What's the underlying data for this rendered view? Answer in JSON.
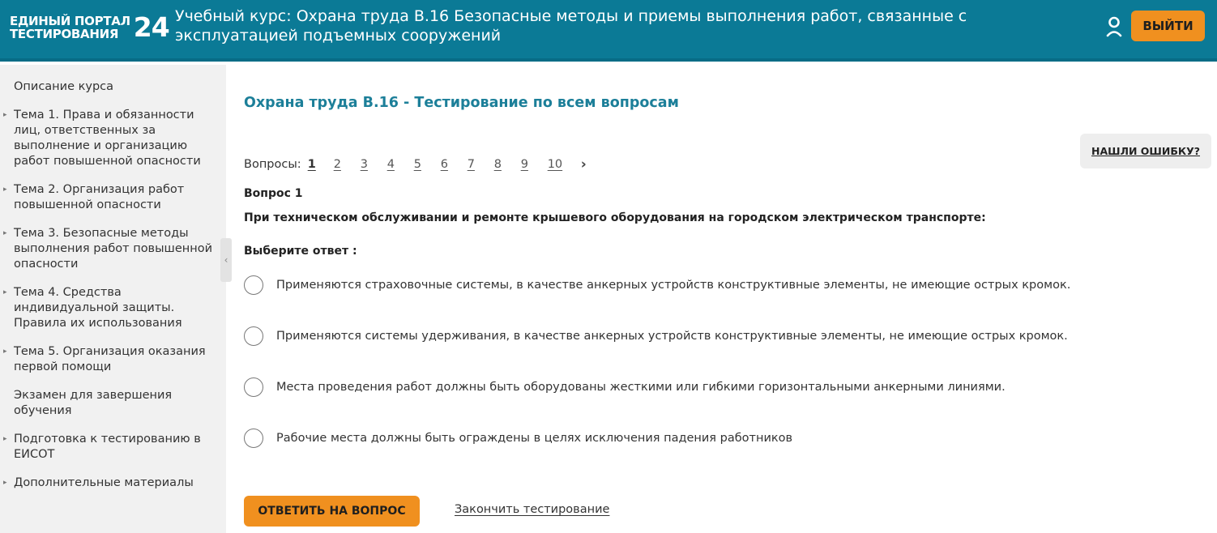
{
  "header": {
    "logo_line1": "ЕДИНЫЙ ПОРТАЛ",
    "logo_line2": "ТЕСТИРОВАНИЯ",
    "logo_number": "24",
    "title": "Учебный курс: Охрана труда В.16 Безопасные методы и приемы выполнения работ, связанные с эксплуатацией подъемных сооружений",
    "user_icon": "user-icon",
    "logout_label": "ВЫЙТИ"
  },
  "sidebar": {
    "items": [
      {
        "label": "Описание курса",
        "arrow": false
      },
      {
        "label": "Тема 1. Права и обязанности лиц, ответственных за выполнение и организацию работ повышенной опасности",
        "arrow": true
      },
      {
        "label": "Тема 2. Организация работ повышенной опасности",
        "arrow": true
      },
      {
        "label": "Тема 3. Безопасные методы выполнения работ повышенной опасности",
        "arrow": true
      },
      {
        "label": "Тема 4. Средства индивидуальной защиты. Правила их использования",
        "arrow": true
      },
      {
        "label": "Тема 5. Организация оказания первой помощи",
        "arrow": true
      },
      {
        "label": "Экзамен для завершения обучения",
        "arrow": false
      },
      {
        "label": "Подготовка к тестированию в ЕИСОТ",
        "arrow": true
      },
      {
        "label": "Дополнительные материалы",
        "arrow": true
      }
    ]
  },
  "main": {
    "title": "Охрана труда В.16 - Тестирование по всем вопросам",
    "report_error_label": "НАШЛИ ОШИБКУ?",
    "pager": {
      "label": "Вопросы:",
      "pages": [
        "1",
        "2",
        "3",
        "4",
        "5",
        "6",
        "7",
        "8",
        "9",
        "10"
      ],
      "current": "1",
      "next": "›"
    },
    "question_number": "Вопрос 1",
    "question_text": "При техническом обслуживании и ремонте крышевого оборудования на городском электрическом транспорте:",
    "choose_label": "Выберите ответ :",
    "options": [
      "Применяются страховочные системы, в качестве анкерных устройств конструктивные элементы, не имеющие острых кромок.",
      "Применяются системы удерживания, в качестве анкерных устройств конструктивные элементы, не имеющие острых кромок.",
      "Места проведения работ должны быть оборудованы жесткими или гибкими горизонтальными анкерными линиями.",
      "Рабочие места должны быть ограждены в целях исключения падения работников"
    ],
    "answer_button": "ОТВЕТИТЬ НА ВОПРОС",
    "finish_link": "Закончить тестирование"
  },
  "colors": {
    "header_bg": "#0b7a96",
    "accent_orange": "#f0901f",
    "title_teal": "#1c7f99",
    "sidebar_bg": "#f1f1f1"
  }
}
